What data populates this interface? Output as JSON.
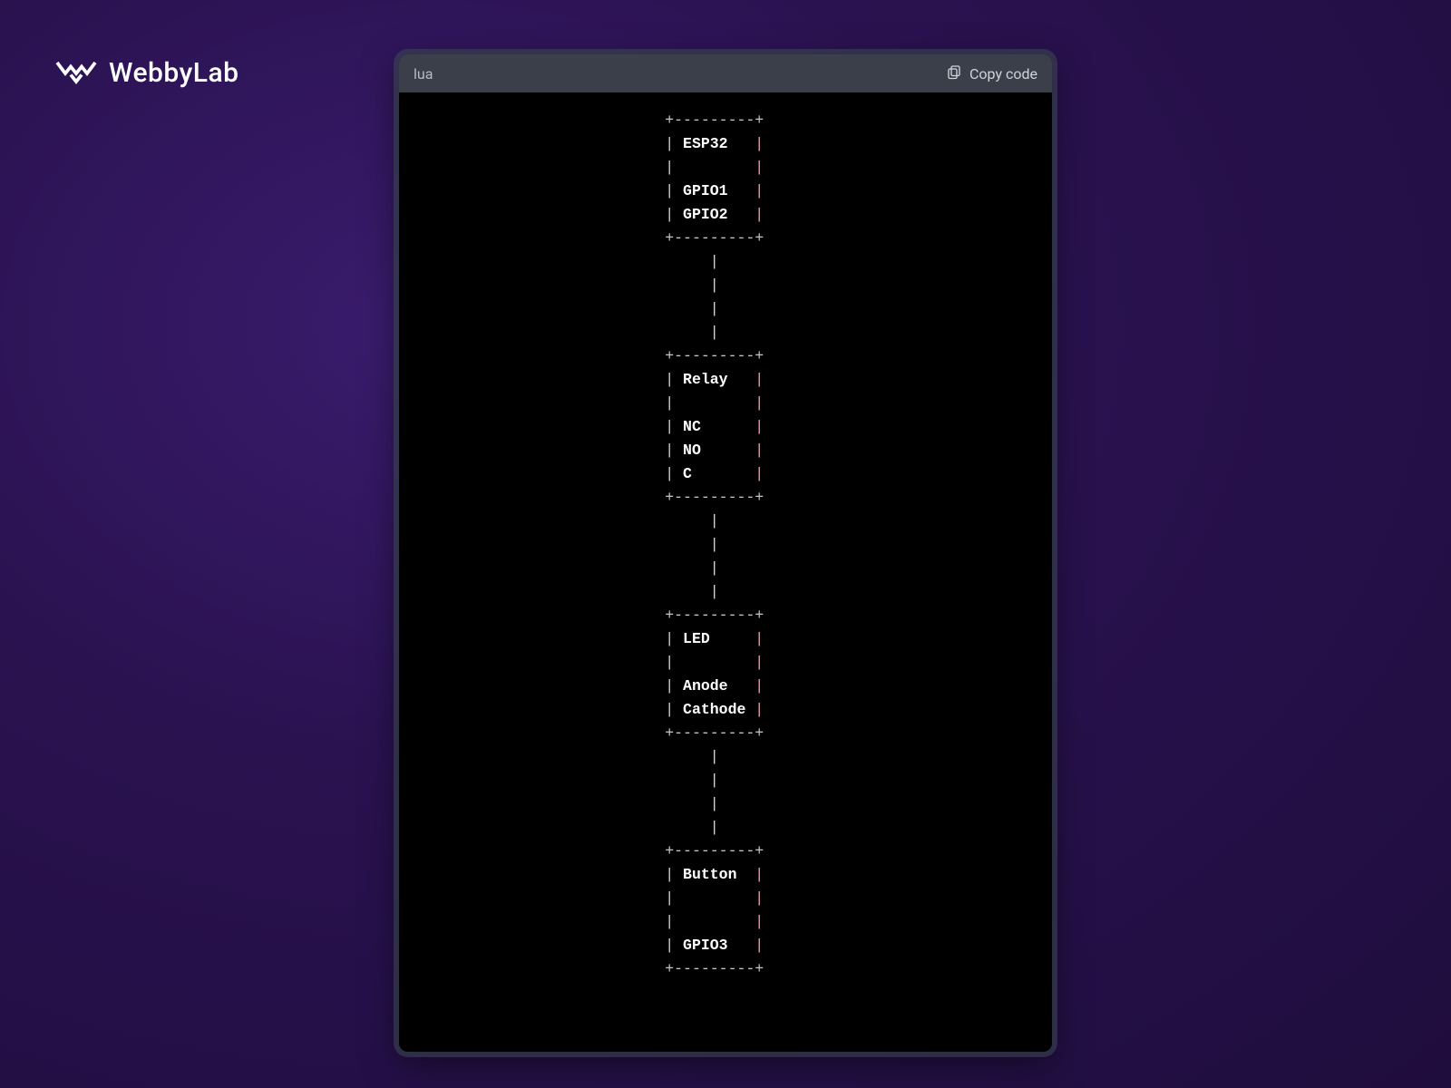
{
  "brand": {
    "name": "WebbyLab"
  },
  "code_block": {
    "language": "lua",
    "copy_label": "Copy code"
  },
  "diagram": {
    "indent_cols": 28,
    "connector_len": 4,
    "blocks": [
      {
        "title": "ESP32",
        "lines": [
          "",
          "GPIO1",
          "GPIO2"
        ]
      },
      {
        "title": "Relay",
        "lines": [
          "",
          "NC",
          "NO",
          "C"
        ]
      },
      {
        "title": "LED",
        "lines": [
          "",
          "Anode",
          "Cathode"
        ]
      },
      {
        "title": "Button",
        "lines": [
          "",
          "",
          "GPIO3"
        ]
      }
    ]
  }
}
